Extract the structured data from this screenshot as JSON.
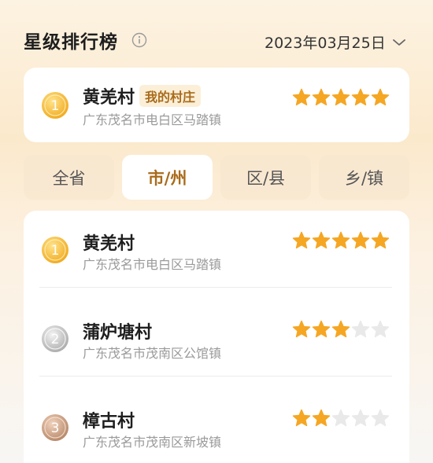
{
  "header": {
    "title": "星级排行榜",
    "date": "2023年03月25日"
  },
  "my_village": {
    "rank": "1",
    "name": "黄羌村",
    "badge": "我的村庄",
    "address": "广东茂名市电白区马踏镇",
    "stars": 5,
    "max_stars": 5
  },
  "tabs": [
    {
      "label": "全省",
      "active": false
    },
    {
      "label": "市/州",
      "active": true
    },
    {
      "label": "区/县",
      "active": false
    },
    {
      "label": "乡/镇",
      "active": false
    }
  ],
  "ranking": [
    {
      "rank": "1",
      "name": "黄羌村",
      "address": "广东茂名市电白区马踏镇",
      "stars": 5,
      "medal": "gold"
    },
    {
      "rank": "2",
      "name": "蒲炉塘村",
      "address": "广东茂名市茂南区公馆镇",
      "stars": 3,
      "medal": "silver"
    },
    {
      "rank": "3",
      "name": "樟古村",
      "address": "广东茂名市茂南区新坡镇",
      "stars": 2,
      "medal": "bronze"
    }
  ],
  "colors": {
    "star_on": "#f5a623",
    "star_off": "#e9e9e9",
    "accent": "#a96b1a"
  },
  "icons": {
    "info": "info-circle-icon",
    "dropdown": "chevron-down-icon",
    "star": "star-icon",
    "medal": "medal-icon"
  }
}
